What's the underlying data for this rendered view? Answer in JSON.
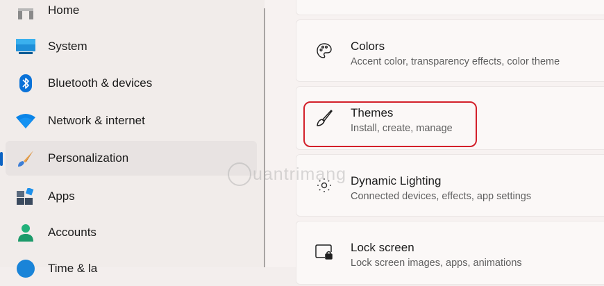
{
  "sidebar": {
    "items": [
      {
        "label": "Home",
        "icon": "home-icon"
      },
      {
        "label": "System",
        "icon": "system-icon"
      },
      {
        "label": "Bluetooth & devices",
        "icon": "bluetooth-icon"
      },
      {
        "label": "Network & internet",
        "icon": "wifi-icon"
      },
      {
        "label": "Personalization",
        "icon": "brush-icon",
        "selected": true
      },
      {
        "label": "Apps",
        "icon": "apps-icon"
      },
      {
        "label": "Accounts",
        "icon": "account-icon"
      },
      {
        "label": "Time & la",
        "icon": "globe-icon"
      }
    ]
  },
  "main": {
    "cards": [
      {
        "title": "Colors",
        "subtitle": "Accent color, transparency effects, color theme",
        "icon": "palette-icon"
      },
      {
        "title": "Themes",
        "subtitle": "Install, create, manage",
        "icon": "brush-outline-icon",
        "highlighted": true
      },
      {
        "title": "Dynamic Lighting",
        "subtitle": "Connected devices, effects, app settings",
        "icon": "lighting-icon"
      },
      {
        "title": "Lock screen",
        "subtitle": "Lock screen images, apps, animations",
        "icon": "lock-screen-icon"
      }
    ]
  },
  "watermark": {
    "text": "uantrimang"
  },
  "colors": {
    "accent": "#0b63c3",
    "highlight": "#d3202a"
  }
}
